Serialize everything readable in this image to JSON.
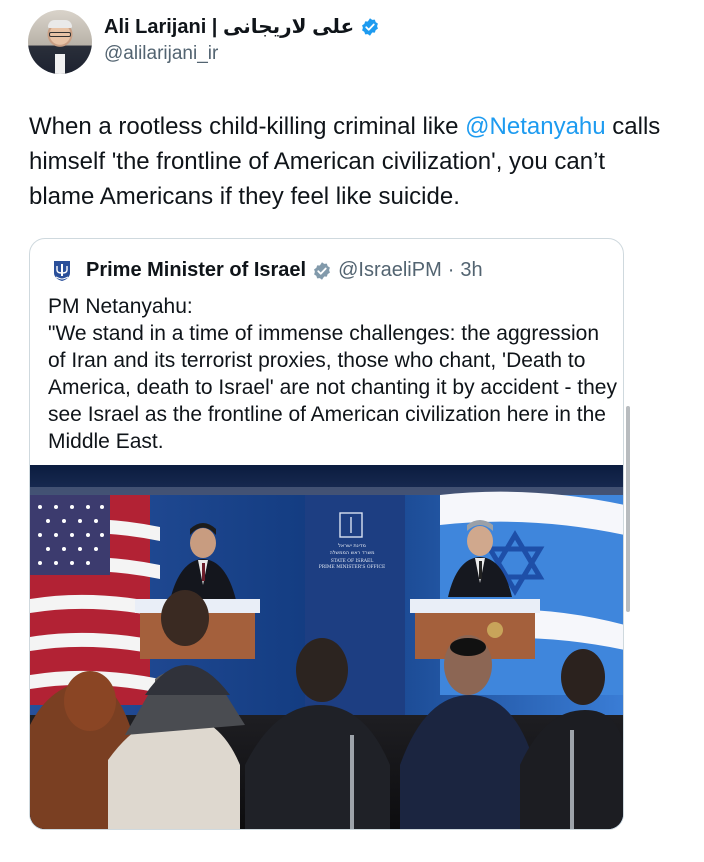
{
  "author": {
    "display_name": "Ali Larijani | علی لاریجانی",
    "handle": "@alilarijani_ir",
    "verified_color": "#1d9bf0"
  },
  "tweet": {
    "text_before": "When a rootless child-killing criminal like ",
    "mention": "@Netanyahu",
    "text_after": " calls himself 'the frontline of American civilization', you can’t blame Americans if they feel like suicide."
  },
  "quoted": {
    "display_name": "Prime Minister of Israel",
    "handle": "@IsraeliPM",
    "separator": "·",
    "time": "3h",
    "badge_color": "#829aab",
    "line1": "PM Netanyahu:",
    "line2": "\"We stand in a time of immense challenges: the aggression of Iran and its terrorist proxies, those who chant, 'Death to America, death to Israel' are not chanting it by accident - they see Israel as the frontline of American civilization here in the Middle East."
  },
  "photo": {
    "backdrop_line1": "מדינת ישראל",
    "backdrop_line2": "משרד ראש הממשלה",
    "backdrop_line3": "STATE OF ISRAEL",
    "backdrop_line4": "PRIME MINISTER'S OFFICE"
  },
  "colors": {
    "text": "#0f1419",
    "secondary": "#536471",
    "link": "#1d9bf0",
    "border": "#cfd9de"
  }
}
